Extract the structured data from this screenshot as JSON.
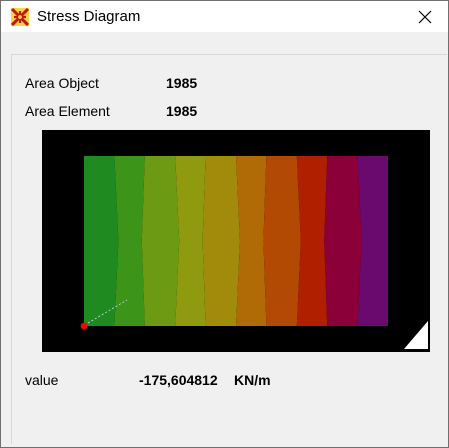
{
  "window": {
    "title": "Stress Diagram",
    "icon": "sap-x-icon",
    "close_icon": "close-icon"
  },
  "info": {
    "area_object_label": "Area Object",
    "area_object_value": "1985",
    "area_element_label": "Area Element",
    "area_element_value": "1985"
  },
  "plot": {
    "background": "#000000",
    "colors": [
      "#1f8a1f",
      "#3c9418",
      "#6c9a12",
      "#8f9a0e",
      "#a28a0a",
      "#b06a06",
      "#b24a04",
      "#b02000",
      "#8c003a",
      "#6a0a6e"
    ],
    "marker_color": "#ff0000"
  },
  "result": {
    "label": "value",
    "value": "-175,604812",
    "unit": "KN/m"
  }
}
